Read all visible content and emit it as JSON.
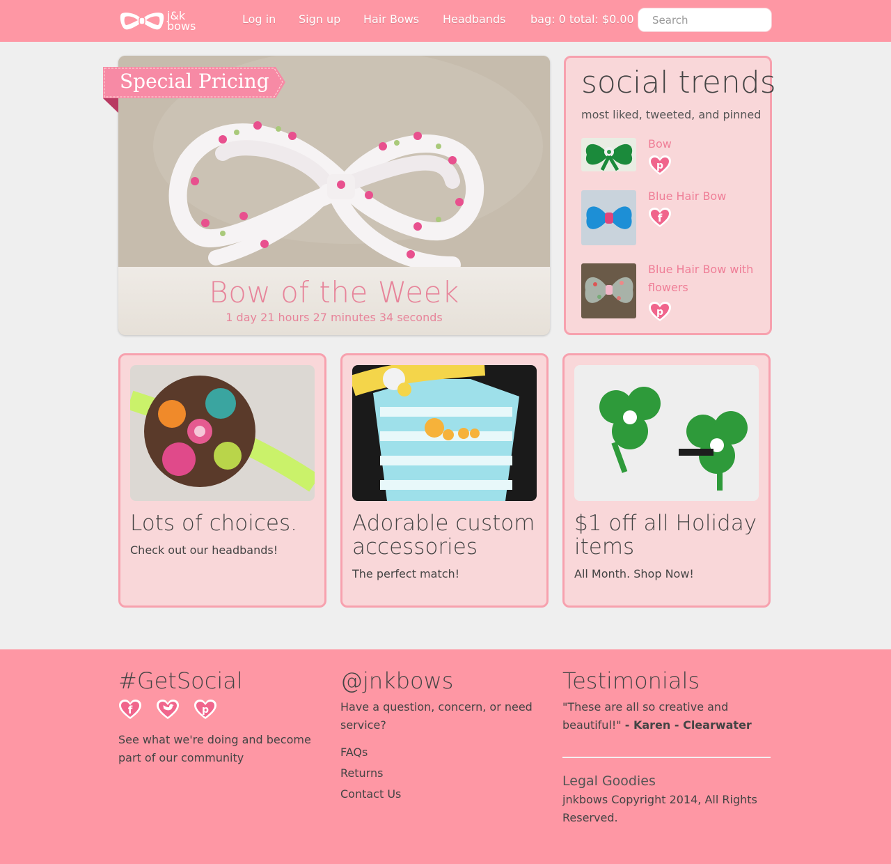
{
  "nav": {
    "logo_line1": "j&k",
    "logo_line2": "bows",
    "login": "Log in",
    "signup": "Sign up",
    "hair_bows": "Hair Bows",
    "headbands": "Headbands",
    "bag": "bag: 0 total: $0.00",
    "search_placeholder": "Search"
  },
  "feature": {
    "ribbon": "Special Pricing",
    "title": "Bow of the Week",
    "countdown": "1 day 21 hours 27 minutes 34 seconds"
  },
  "trends": {
    "title": "social trends",
    "subtitle": "most liked, tweeted, and pinned",
    "items": [
      {
        "name": "Bow",
        "icon": "pinterest-heart-icon"
      },
      {
        "name": "Blue Hair Bow",
        "icon": "facebook-heart-icon"
      },
      {
        "name": "Blue Hair Bow with flowers",
        "icon": "pinterest-heart-icon"
      }
    ]
  },
  "cards": [
    {
      "title": "Lots of choices.",
      "text": "Check out our headbands!"
    },
    {
      "title": "Adorable custom accessories",
      "text": "The perfect match!"
    },
    {
      "title": "$1 off all Holiday items",
      "text": "All Month. Shop Now!"
    }
  ],
  "footer": {
    "social_title": "#GetSocial",
    "social_text": "See what we're doing and become part of our community",
    "contact_title": "@jnkbows",
    "contact_text": "Have a question, concern, or need service?",
    "links": [
      "FAQs",
      "Returns",
      "Contact Us"
    ],
    "testimonials_title": "Testimonials",
    "testimonial_quote": "\"These are all so creative and beautiful!\"",
    "testimonial_author": "- Karen - Clearwater",
    "legal_title": "Legal Goodies",
    "legal_text": "jnkbows Copyright 2014, All Rights Reserved."
  },
  "colors": {
    "nav_pink": "#fe97a4",
    "card_bg": "#f9d7d9",
    "card_border": "#f7a1ae",
    "accent_text": "#ef7e97",
    "page_bg": "#efefef"
  }
}
